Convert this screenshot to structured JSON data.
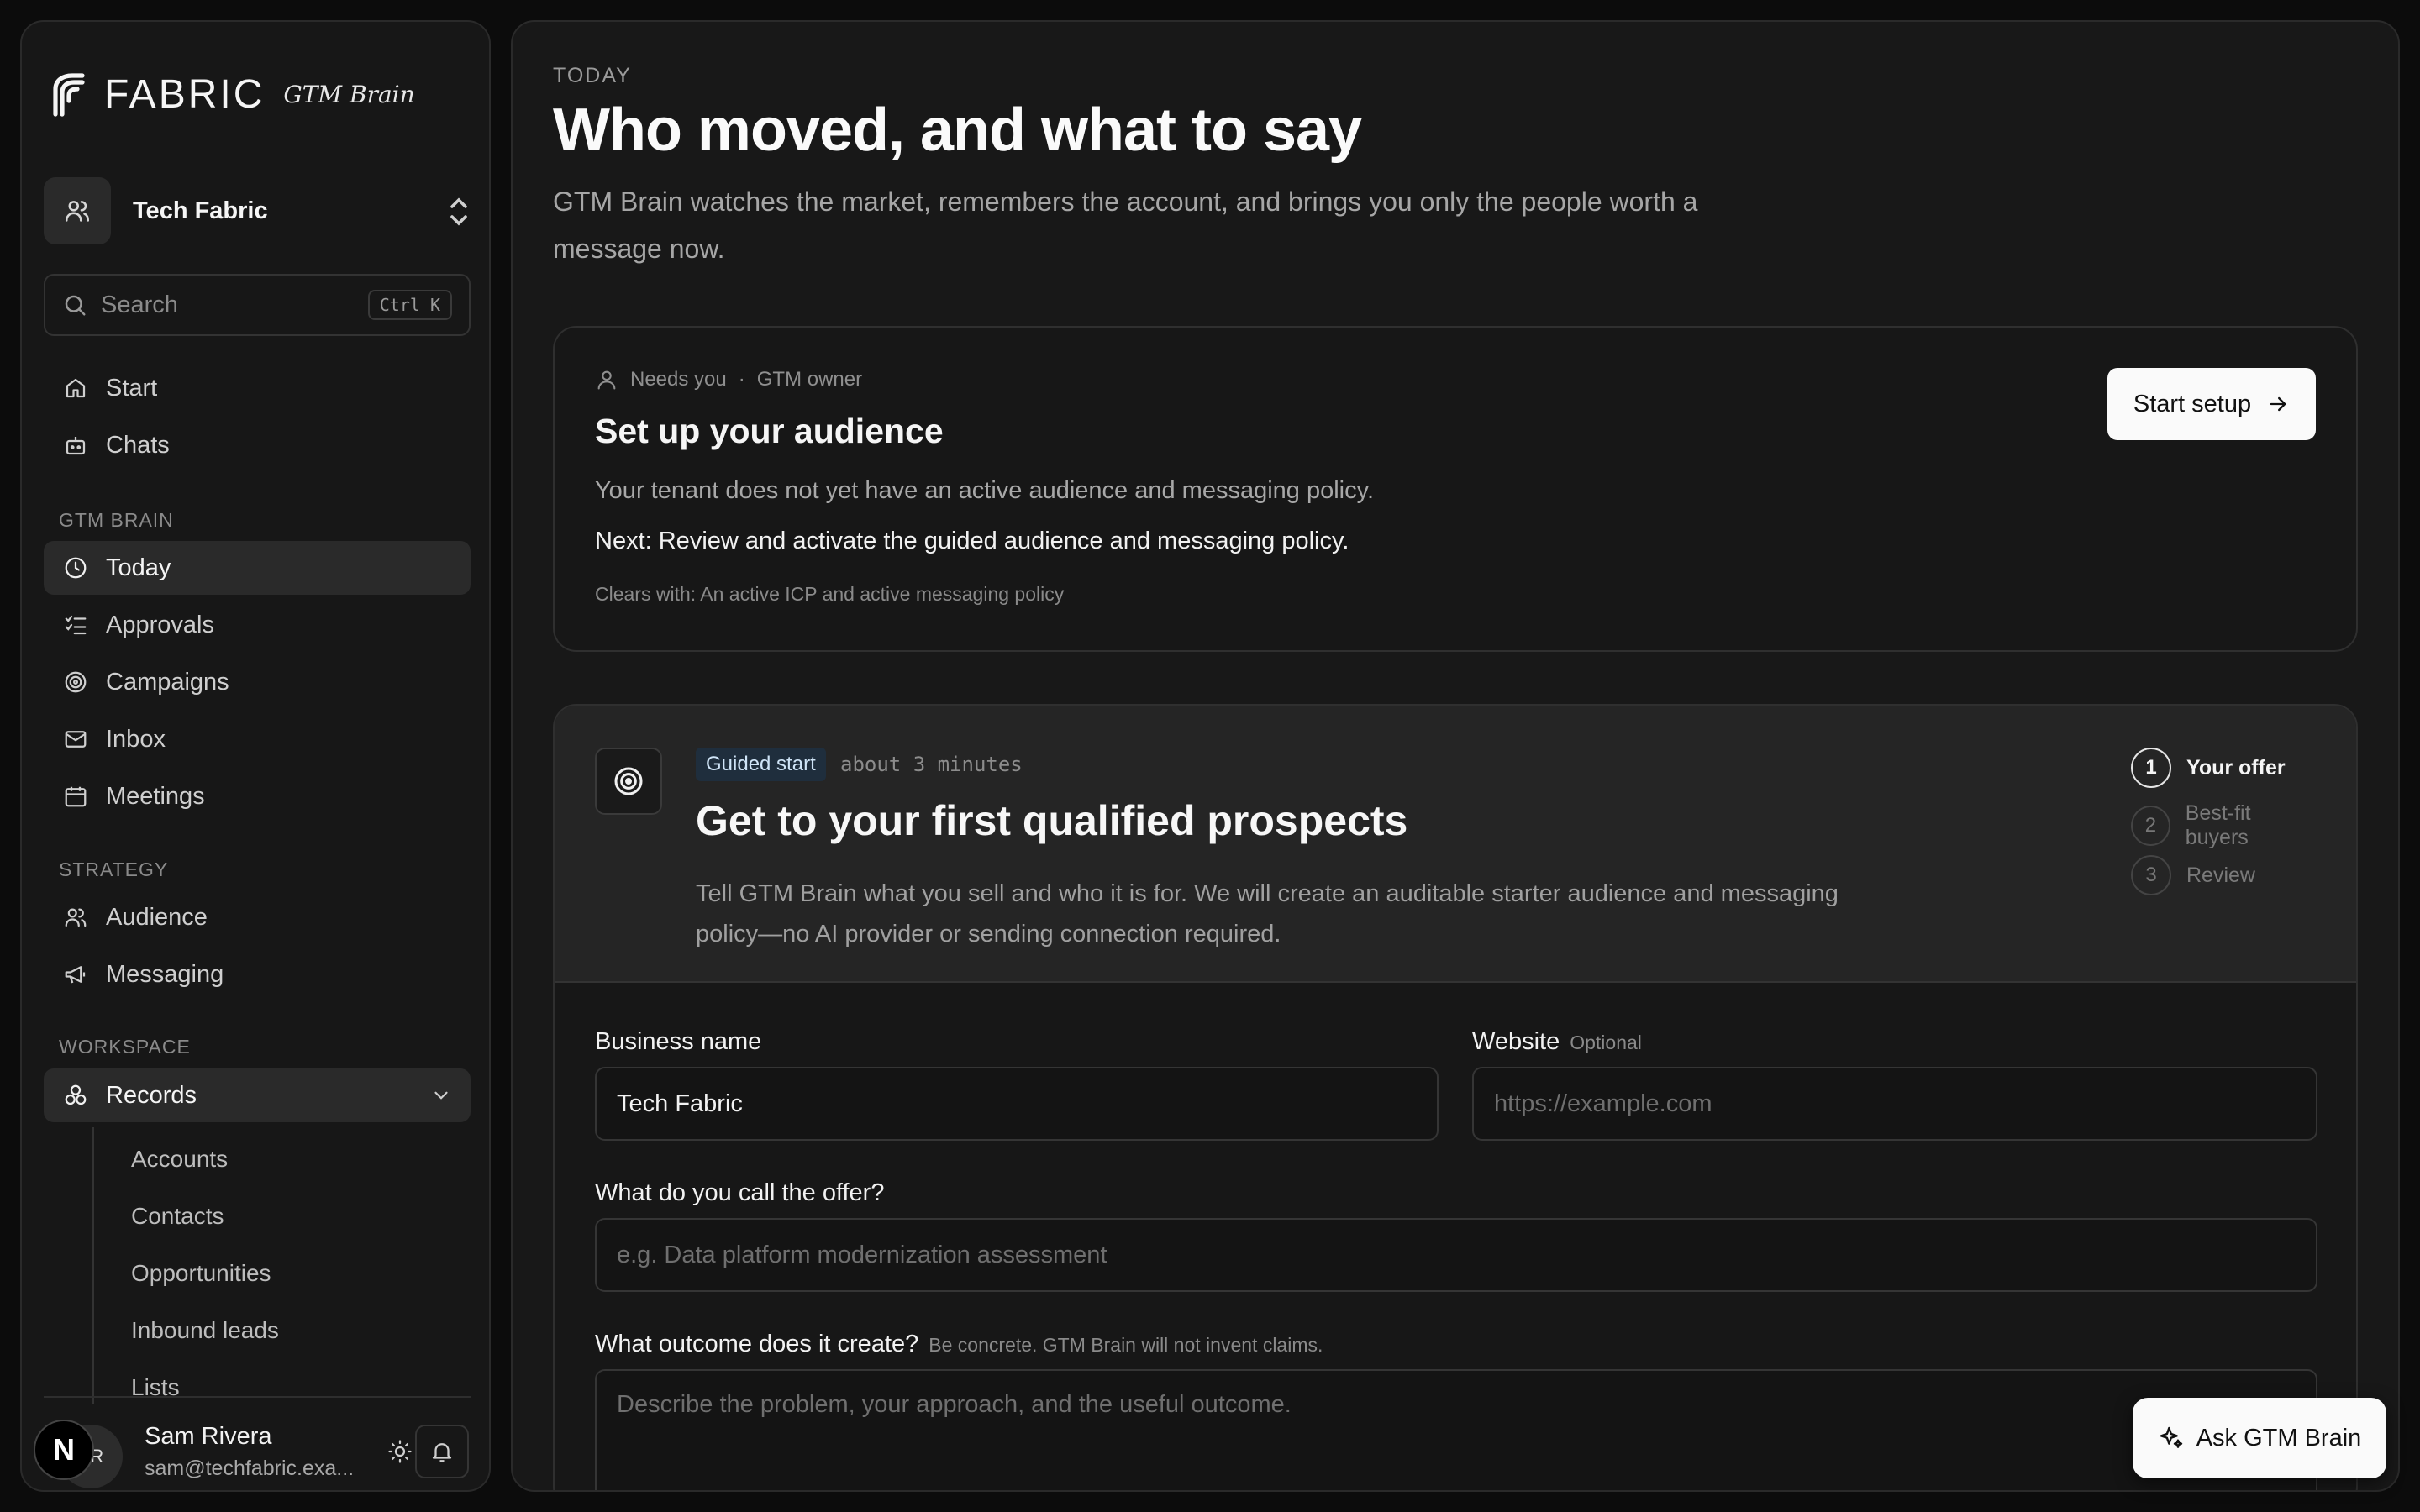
{
  "brand": {
    "name": "FABRIC",
    "product": "GTM Brain"
  },
  "tenant": {
    "name": "Tech Fabric"
  },
  "search": {
    "label": "Search",
    "shortcut": "Ctrl K"
  },
  "nav": {
    "primary": [
      {
        "label": "Start",
        "icon": "home-icon"
      },
      {
        "label": "Chats",
        "icon": "bot-icon"
      }
    ],
    "gtm_section": "GTM BRAIN",
    "gtm": [
      {
        "label": "Today",
        "icon": "clock-icon",
        "active": true
      },
      {
        "label": "Approvals",
        "icon": "checklist-icon"
      },
      {
        "label": "Campaigns",
        "icon": "target-icon"
      },
      {
        "label": "Inbox",
        "icon": "mail-icon"
      },
      {
        "label": "Meetings",
        "icon": "calendar-icon"
      }
    ],
    "strategy_section": "STRATEGY",
    "strategy": [
      {
        "label": "Audience",
        "icon": "users-icon"
      },
      {
        "label": "Messaging",
        "icon": "megaphone-icon"
      }
    ],
    "workspace_section": "WORKSPACE",
    "records": {
      "label": "Records",
      "icon": "cubes-icon"
    },
    "records_children": [
      "Accounts",
      "Contacts",
      "Opportunities",
      "Inbound leads",
      "Lists"
    ]
  },
  "user": {
    "initials": "SR",
    "name": "Sam Rivera",
    "email": "sam@techfabric.exa..."
  },
  "page": {
    "eyebrow": "TODAY",
    "title": "Who moved, and what to say",
    "lede": "GTM Brain watches the market, remembers the account, and brings you only the people worth a message now."
  },
  "setup_card": {
    "meta_status": "Needs you",
    "meta_sep": "·",
    "meta_owner": "GTM owner",
    "title": "Set up your audience",
    "body": "Your tenant does not yet have an active audience and messaging policy.",
    "next": "Next: Review and activate the guided audience and messaging policy.",
    "clears": "Clears with: An active ICP and active messaging policy",
    "button": "Start setup"
  },
  "guided_card": {
    "badge": "Guided start",
    "duration": "about 3 minutes",
    "title": "Get to your first qualified prospects",
    "description": "Tell GTM Brain what you sell and who it is for. We will create an auditable starter audience and messaging policy—no AI provider or sending connection required.",
    "steps": [
      {
        "num": "1",
        "label": "Your offer",
        "current": true
      },
      {
        "num": "2",
        "label": "Best-fit buyers"
      },
      {
        "num": "3",
        "label": "Review"
      }
    ],
    "form": {
      "business_label": "Business name",
      "business_value": "Tech Fabric",
      "website_label": "Website",
      "website_hint": "Optional",
      "website_placeholder": "https://example.com",
      "offer_label": "What do you call the offer?",
      "offer_placeholder": "e.g. Data platform modernization assessment",
      "outcome_label": "What outcome does it create?",
      "outcome_hint": "Be concrete. GTM Brain will not invent claims.",
      "outcome_placeholder": "Describe the problem, your approach, and the useful outcome."
    }
  },
  "ask_button": "Ask GTM Brain"
}
